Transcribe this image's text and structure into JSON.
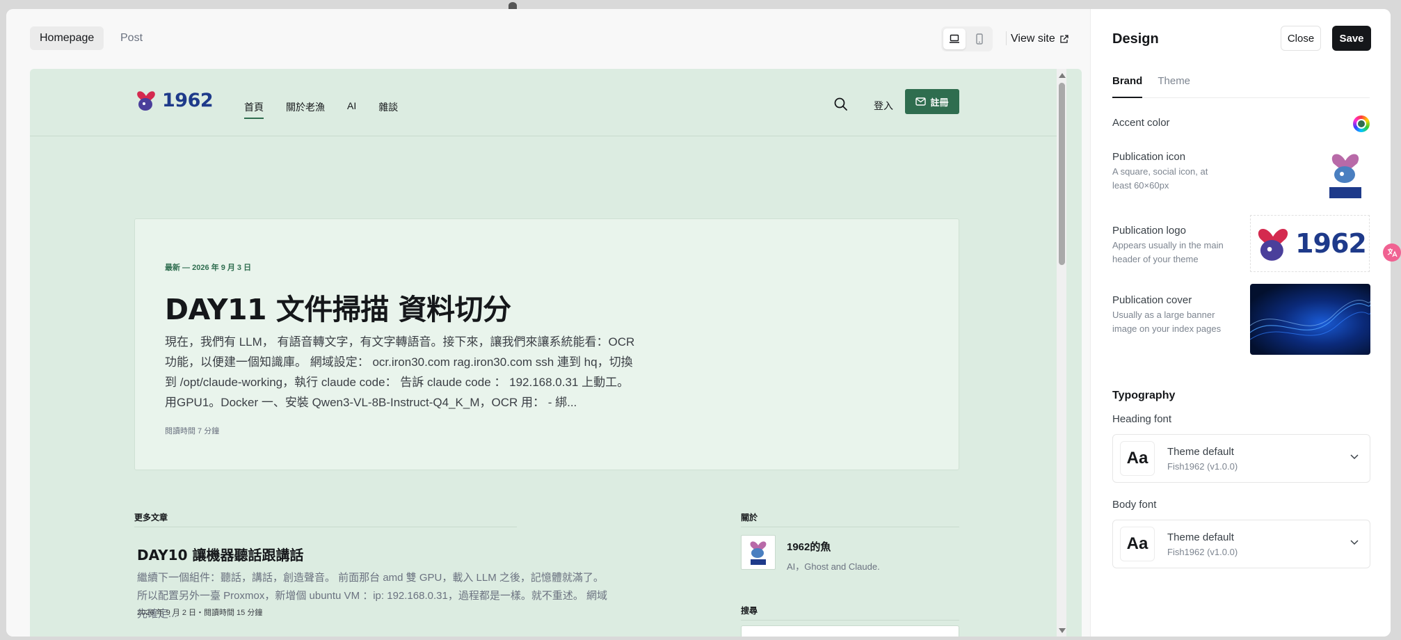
{
  "preview": {
    "tabs": [
      "Homepage",
      "Post"
    ],
    "view_site": "View site"
  },
  "site": {
    "logo_text": "1962",
    "nav": [
      "首頁",
      "關於老漁",
      "AI",
      "雜談"
    ],
    "signin": "登入",
    "signup": "註冊",
    "hero": {
      "meta": "最新 — 2026 年 9 月 3 日",
      "title": "DAY11 文件掃描 資料切分",
      "excerpt": "現在，我們有 LLM， 有語音轉文字，有文字轉語音。接下來，讓我們來讓系統能看：OCR 功能，以便建一個知識庫。 網域設定： ocr.iron30.com rag.iron30.com ssh 連到 hq，切換到 /opt/claude-working，執行 claude code： 告訴 claude code ： 192.168.0.31 上動工。用GPU1。Docker 一、安裝 Qwen3-VL-8B-Instruct-Q4_K_M，OCR 用： - 綁...",
      "read_time": "閱讀時間 7 分鐘"
    },
    "more_label": "更多文章",
    "post": {
      "title": "DAY10 讓機器聽話跟講話",
      "excerpt": "繼續下一個組件：聽話，講話，創造聲音。 前面那台 amd 雙 GPU，載入 LLM 之後，記憶體就滿了。 所以配置另外一臺 Proxmox，新增個 ubuntu VM ：ip: 192.168.0.31，過程都是一樣。就不重述。 網域先確定...",
      "meta": "2026 年 9 月 2 日・閱讀時間 15 分鐘"
    },
    "about_label": "關於",
    "about_name": "1962的魚",
    "about_desc": "AI，Ghost and Claude.",
    "search_label": "搜尋"
  },
  "panel": {
    "title": "Design",
    "close": "Close",
    "save": "Save",
    "tabs": [
      "Brand",
      "Theme"
    ],
    "accent_label": "Accent color",
    "accent_color": "#2f6d4f",
    "icon_label": "Publication icon",
    "icon_hint": "A square, social icon, at least 60×60px",
    "logo_label": "Publication logo",
    "logo_hint": "Appears usually in the main header of your theme",
    "logo_text": "1962",
    "cover_label": "Publication cover",
    "cover_hint": "Usually as a large banner image on your index pages",
    "typography": "Typography",
    "heading_font_label": "Heading font",
    "body_font_label": "Body font",
    "font_sample": "Aa",
    "font_name": "Theme default",
    "font_sub": "Fish1962 (v1.0.0)"
  },
  "colors": {
    "brand_green": "#2f6d4f",
    "preview_bg": "#dcece1",
    "logo_blue": "#1e3a8a"
  }
}
